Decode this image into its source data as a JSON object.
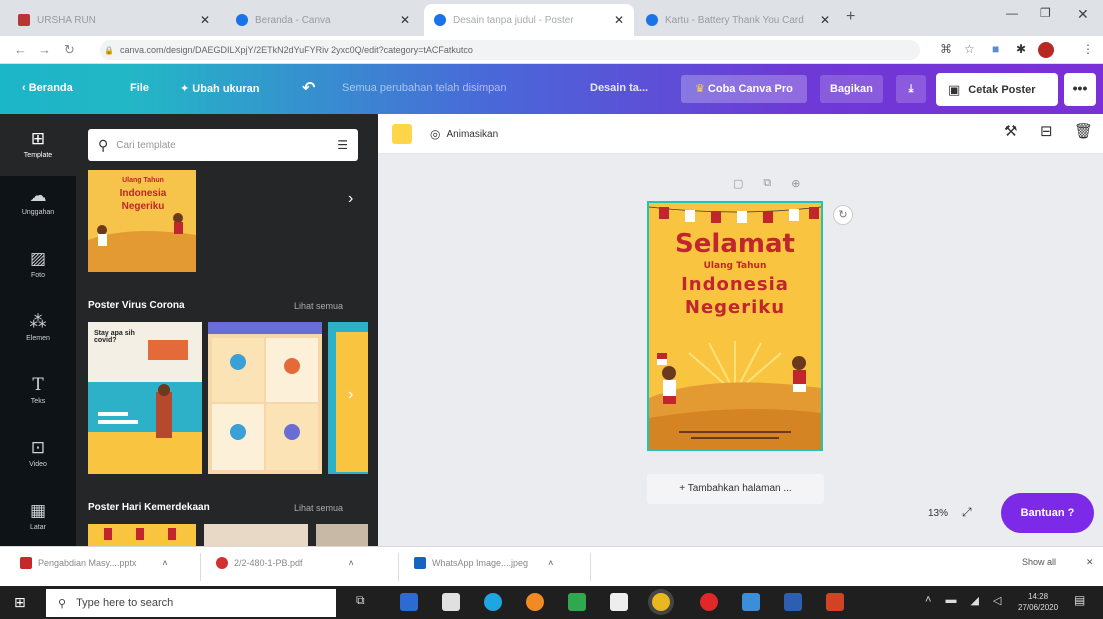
{
  "browser": {
    "tabs": [
      {
        "label": "URSHA RUN",
        "favicon_color": "#b73535",
        "active": false
      },
      {
        "label": "Beranda - Canva",
        "favicon_color": "#1a73e8",
        "active": false
      },
      {
        "label": "Desain tanpa judul - Poster",
        "favicon_color": "#1a73e8",
        "active": true
      },
      {
        "label": "Kartu - Battery Thank You Card",
        "favicon_color": "#1a73e8",
        "active": false
      }
    ],
    "url": "canva.com/design/DAEGDILXpjY/2ETkN2dYuFYRiv 2yxc0Q/edit?category=tACFatkutco"
  },
  "canva_header": {
    "back_label": "Beranda",
    "file_label": "File",
    "resize_label": "Ubah ukuran",
    "saved_status": "Semua perubahan telah disimpan",
    "design_title": "Desain ta...",
    "pro_label": "Coba Canva Pro",
    "share_label": "Bagikan",
    "print_label": "Cetak Poster",
    "more_label": "•••"
  },
  "sidebar": {
    "items": [
      {
        "label": "Template",
        "icon": "template-icon"
      },
      {
        "label": "Unggahan",
        "icon": "upload-icon"
      },
      {
        "label": "Foto",
        "icon": "photo-icon"
      },
      {
        "label": "Elemen",
        "icon": "elements-icon"
      },
      {
        "label": "Teks",
        "icon": "text-icon"
      },
      {
        "label": "Video",
        "icon": "video-icon"
      },
      {
        "label": "Latar",
        "icon": "background-icon"
      }
    ]
  },
  "panel": {
    "search_placeholder": "Cari template",
    "sections": [
      {
        "title": "Poster Virus Corona",
        "link": "Lihat semua"
      },
      {
        "title": "Poster Hari Kemerdekaan",
        "link": "Lihat semua"
      }
    ],
    "thumb_top_lines": [
      "Ulang Tahun",
      "Indonesia",
      "Negeriku"
    ],
    "corona_thumb_text": "Stay apa sih covid?"
  },
  "editor": {
    "animate_label": "Animasikan",
    "poster_lines": [
      "Selamat",
      "Ulang Tahun",
      "Indonesia",
      "Negeriku"
    ],
    "add_page_label": "+ Tambahkan halaman ...",
    "zoom": "13%",
    "help_label": "Bantuan ?"
  },
  "downloads": [
    {
      "name": "Pengabdian Masy....pptx",
      "icon_color": "#c62828"
    },
    {
      "name": "2/2-480-1-PB.pdf",
      "icon_color": "#d32f2f"
    },
    {
      "name": "WhatsApp Image....jpeg",
      "icon_color": "#1565c0"
    }
  ],
  "downloads_show_all": "Show all",
  "taskbar": {
    "search_placeholder": "Type here to search",
    "time": "14:28",
    "date": "27/06/2020"
  },
  "colors": {
    "canva_purple": "#7d2ae8",
    "poster_yellow": "#f9c541",
    "poster_red": "#c0262c"
  }
}
